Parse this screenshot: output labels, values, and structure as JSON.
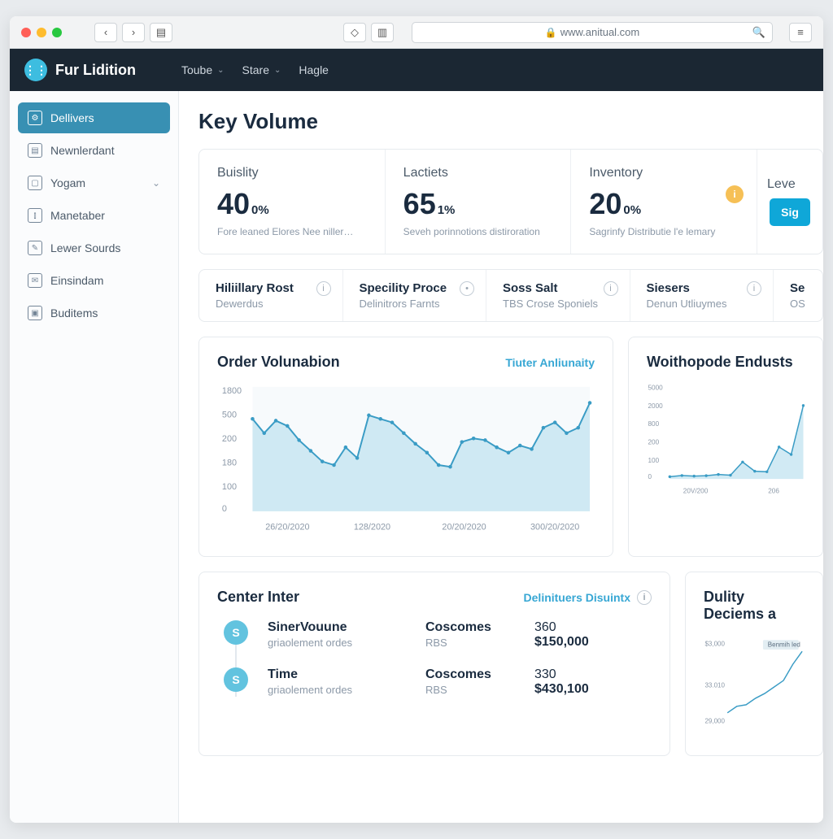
{
  "chrome": {
    "url_host": "www.anitual.com"
  },
  "brand": "Fur Lidition",
  "nav": [
    {
      "label": "Toube",
      "has_caret": true
    },
    {
      "label": "Stare",
      "has_caret": true
    },
    {
      "label": "Hagle",
      "has_caret": false
    }
  ],
  "sidebar": {
    "items": [
      {
        "label": "Dellivers",
        "active": true,
        "chevron": false
      },
      {
        "label": "Newnlerdant",
        "active": false,
        "chevron": false
      },
      {
        "label": "Yogam",
        "active": false,
        "chevron": true
      },
      {
        "label": "Manetaber",
        "active": false,
        "chevron": false
      },
      {
        "label": "Lewer Sourds",
        "active": false,
        "chevron": false
      },
      {
        "label": "Einsindam",
        "active": false,
        "chevron": false
      },
      {
        "label": "Buditems",
        "active": false,
        "chevron": false
      }
    ]
  },
  "page_title": "Key Volume",
  "kpis": [
    {
      "label": "Buislity",
      "value": "40",
      "unit": "0%",
      "desc": "Fore leaned Elores Nee niller…"
    },
    {
      "label": "Lactiets",
      "value": "65",
      "unit": "1%",
      "desc": "Seveh porinnotions distiroration"
    },
    {
      "label": "Inventory",
      "value": "20",
      "unit": "0%",
      "desc": "Sagrinfy Distributie l'e lemary",
      "badge": "i"
    },
    {
      "label": "Leve",
      "cta": "Sig"
    }
  ],
  "tabs": [
    {
      "title": "Hiliillary Rost",
      "sub": "Dewerdus",
      "info": true
    },
    {
      "title": "Specility Proce",
      "sub": "Delinitrors Farnts",
      "info": true
    },
    {
      "title": "Soss Salt",
      "sub": "TBS Crose Sponiels",
      "info": true
    },
    {
      "title": "Siesers",
      "sub": "Denun Utliuymes",
      "info": true
    },
    {
      "title": "Se",
      "sub": "OS",
      "info": false
    }
  ],
  "chart1": {
    "title": "Order Volunabion",
    "link": "Tiuter Anliunaity",
    "yticks": [
      "1800",
      "500",
      "200",
      "180",
      "100",
      "0"
    ],
    "xticks": [
      "26/20/2020",
      "128/2020",
      "20/20/2020",
      "300/20/2020"
    ]
  },
  "chart2": {
    "title": "Woithopode Endusts",
    "yticks": [
      "5000",
      "2000",
      "800",
      "200",
      "100",
      "0"
    ],
    "xticks": [
      "20V/200",
      "206"
    ]
  },
  "center": {
    "title": "Center Inter",
    "link": "Delinituers Disuintx",
    "rows": [
      {
        "dot": "S",
        "c1_main": "SinerVouune",
        "c1_sub": "griaolement ordes",
        "c2_main": "Coscomes",
        "c2_sub": "RBS",
        "c3_top": "360",
        "c3_bot": "$150,000"
      },
      {
        "dot": "S",
        "c1_main": "Time",
        "c1_sub": "griaolement ordes",
        "c2_main": "Coscomes",
        "c2_sub": "RBS",
        "c3_top": "330",
        "c3_bot": "$430,100"
      }
    ]
  },
  "dulty": {
    "title": "Dulity Deciems a",
    "legend": "Benmih led",
    "yticks": [
      "$3,000",
      "33.010",
      "29,000"
    ]
  },
  "chart_data": [
    {
      "type": "area",
      "title": "Order Volunabion",
      "xlabel": "",
      "ylabel": "",
      "yticks": [
        1800,
        500,
        200,
        180,
        100,
        0
      ],
      "xticks": [
        "26/20/2020",
        "128/2020",
        "20/20/2020",
        "300/20/2020"
      ],
      "series": [
        {
          "name": "orders",
          "values": [
            520,
            440,
            510,
            480,
            400,
            340,
            280,
            260,
            360,
            300,
            540,
            520,
            500,
            440,
            380,
            330,
            260,
            250,
            390,
            410,
            400,
            360,
            330,
            370,
            350,
            470,
            500,
            440,
            470,
            610
          ]
        }
      ]
    },
    {
      "type": "area",
      "title": "Woithopode Endusts",
      "yticks": [
        5000,
        2000,
        800,
        200,
        100,
        0
      ],
      "xticks": [
        "20V/200",
        "206"
      ],
      "series": [
        {
          "name": "endusts",
          "values": [
            120,
            180,
            150,
            170,
            240,
            200,
            900,
            410,
            380,
            1700,
            1300,
            3900
          ]
        }
      ]
    },
    {
      "type": "line",
      "title": "Dulity Deciems",
      "yticks": [
        3000,
        3010,
        29000
      ],
      "series": [
        {
          "name": "Benmih led",
          "values": [
            29000,
            29400,
            29500,
            29900,
            30200,
            30600,
            31000,
            32000,
            32800
          ]
        }
      ]
    }
  ]
}
